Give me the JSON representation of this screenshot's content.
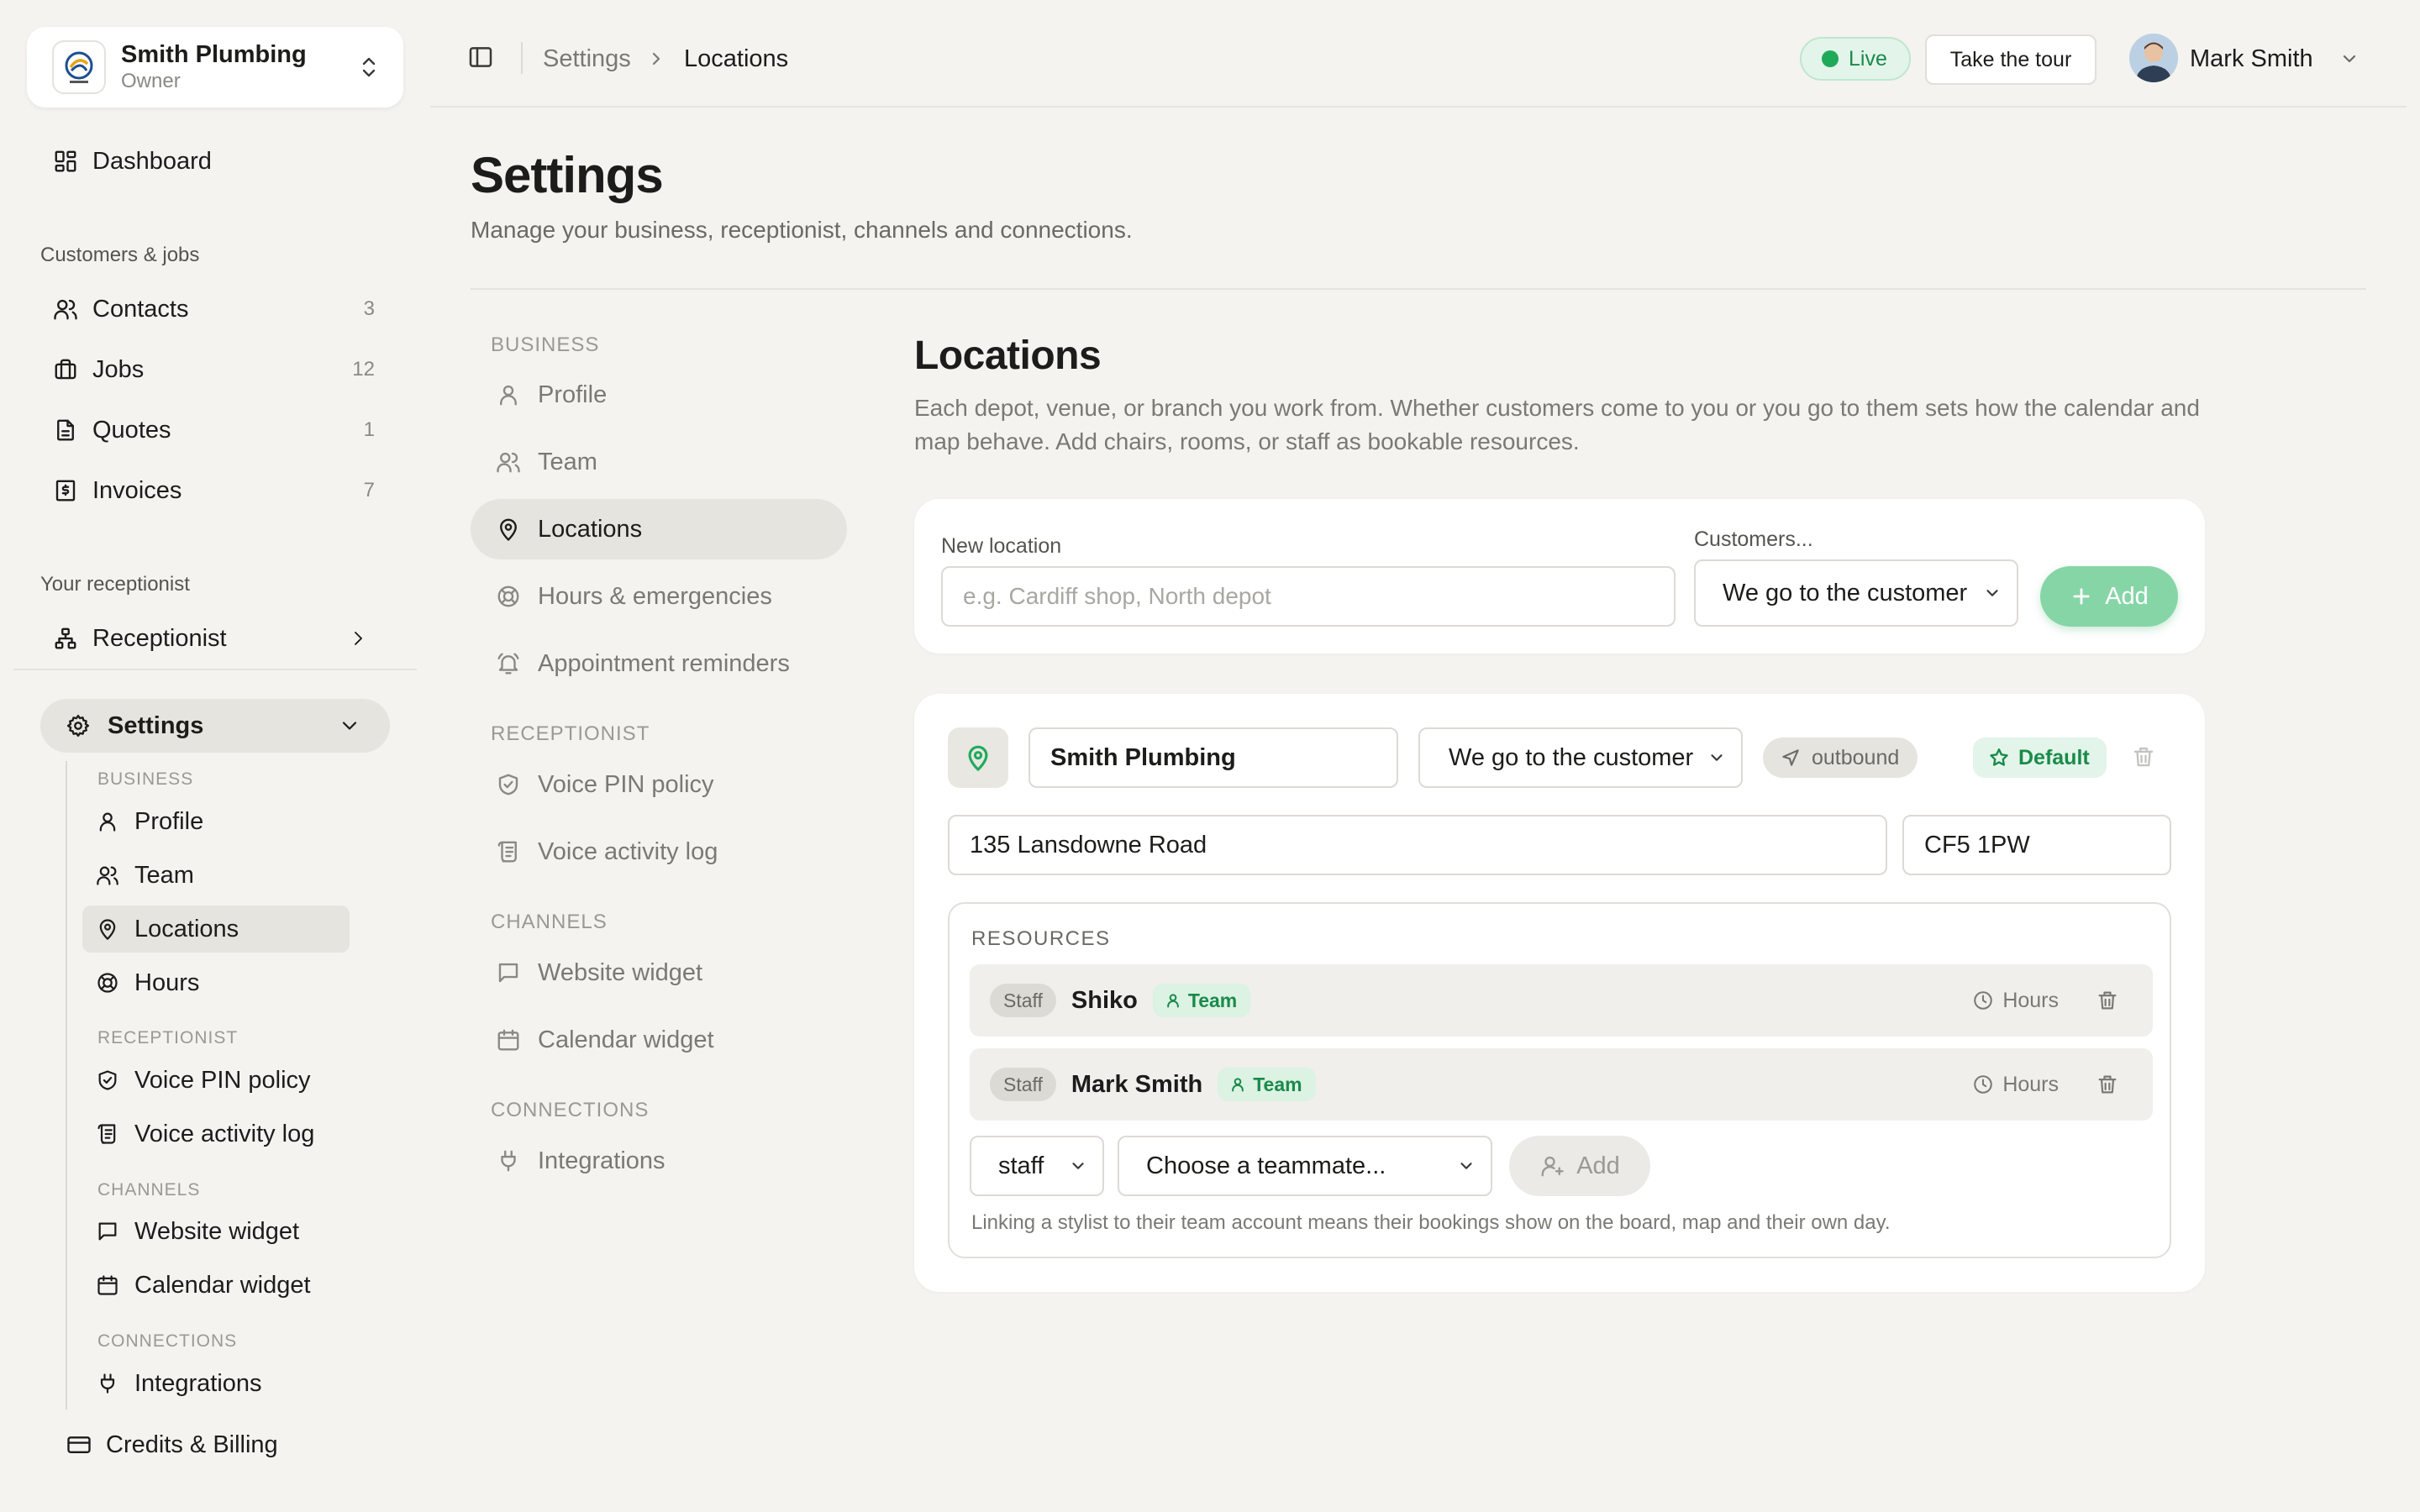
{
  "workspace": {
    "name": "Smith Plumbing",
    "role": "Owner"
  },
  "sidebar": {
    "dashboard": "Dashboard",
    "group_customers": "Customers & jobs",
    "contacts": {
      "label": "Contacts",
      "count": "3"
    },
    "jobs": {
      "label": "Jobs",
      "count": "12"
    },
    "quotes": {
      "label": "Quotes",
      "count": "1"
    },
    "invoices": {
      "label": "Invoices",
      "count": "7"
    },
    "group_receptionist": "Your receptionist",
    "receptionist": "Receptionist",
    "settings": "Settings",
    "sub": {
      "group_business": "BUSINESS",
      "profile": "Profile",
      "team": "Team",
      "locations": "Locations",
      "hours": "Hours",
      "group_receptionist": "RECEPTIONIST",
      "voice_pin": "Voice PIN policy",
      "voice_log": "Voice activity log",
      "group_channels": "CHANNELS",
      "website_widget": "Website widget",
      "calendar_widget": "Calendar widget",
      "group_connections": "CONNECTIONS",
      "integrations": "Integrations"
    },
    "credits": "Credits & Billing"
  },
  "topbar": {
    "crumb_parent": "Settings",
    "crumb_current": "Locations",
    "live_label": "Live",
    "tour_label": "Take the tour",
    "user_name": "Mark Smith"
  },
  "page": {
    "title": "Settings",
    "subtitle": "Manage your business, receptionist, channels and connections."
  },
  "settings_nav": {
    "group_business": "BUSINESS",
    "profile": "Profile",
    "team": "Team",
    "locations": "Locations",
    "hours": "Hours & emergencies",
    "reminders": "Appointment reminders",
    "group_receptionist": "RECEPTIONIST",
    "voice_pin": "Voice PIN policy",
    "voice_log": "Voice activity log",
    "group_channels": "CHANNELS",
    "website_widget": "Website widget",
    "calendar_widget": "Calendar widget",
    "group_connections": "CONNECTIONS",
    "integrations": "Integrations"
  },
  "locations": {
    "title": "Locations",
    "description": "Each depot, venue, or branch you work from. Whether customers come to you or you go to them sets how the calendar and map behave. Add chairs, rooms, or staff as bookable resources.",
    "new": {
      "name_label": "New location",
      "name_placeholder": "e.g. Cardiff shop, North depot",
      "mode_label": "Customers...",
      "mode_value": "We go to the customer",
      "add_label": "Add"
    },
    "location": {
      "name": "Smith Plumbing",
      "mode": "We go to the customer",
      "direction": "outbound",
      "default_label": "Default",
      "address": "135 Lansdowne Road",
      "postcode": "CF5 1PW"
    },
    "resources": {
      "title": "RESOURCES",
      "rows": [
        {
          "type": "Staff",
          "name": "Shiko",
          "badge": "Team",
          "hours": "Hours"
        },
        {
          "type": "Staff",
          "name": "Mark Smith",
          "badge": "Team",
          "hours": "Hours"
        }
      ],
      "type_select": "staff",
      "teammate_select": "Choose a teammate...",
      "add_label": "Add",
      "note": "Linking a stylist to their team account means their bookings show on the board, map and their own day."
    }
  },
  "colors": {
    "accent_green": "#1faa59",
    "add_button": "#86d5a6",
    "background": "#f4f3ef"
  }
}
